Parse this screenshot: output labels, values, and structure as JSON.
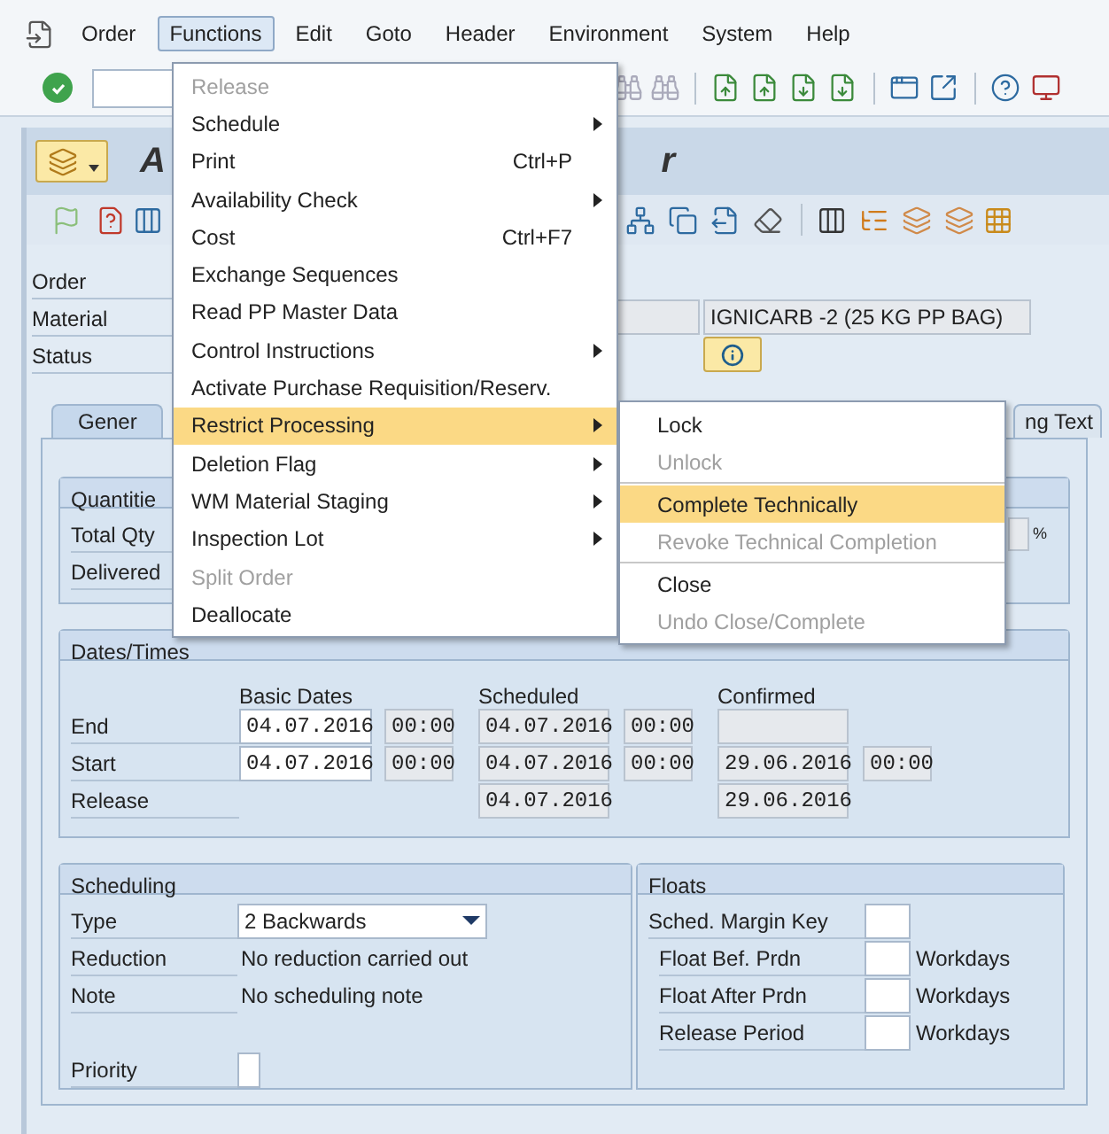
{
  "menu_bar": [
    {
      "label": "Order",
      "selected": false
    },
    {
      "label": "Functions",
      "selected": true
    },
    {
      "label": "Edit",
      "selected": false
    },
    {
      "label": "Goto",
      "selected": false
    },
    {
      "label": "Header",
      "selected": false
    },
    {
      "label": "Environment",
      "selected": false
    },
    {
      "label": "System",
      "selected": false
    },
    {
      "label": "Help",
      "selected": false
    }
  ],
  "title": {
    "visible_start": "A",
    "visible_end": "r"
  },
  "header_fields": [
    {
      "label": "Order"
    },
    {
      "label": "Material",
      "description": "IGNICARB -2 (25 KG PP BAG)"
    },
    {
      "label": "Status"
    }
  ],
  "tabs": [
    {
      "label": "Gener",
      "selected": true
    },
    {
      "label": "ng Text",
      "selected": false
    }
  ],
  "quantities": {
    "title": "Quantitie",
    "rows": [
      {
        "label": "Total Qty",
        "unit": "%"
      },
      {
        "label": "Delivered"
      }
    ]
  },
  "dates": {
    "title": "Dates/Times",
    "columns": [
      "Basic Dates",
      "Scheduled",
      "Confirmed"
    ],
    "rows": [
      {
        "label": "End",
        "basic": {
          "date": {
            "value": "04.07.2016",
            "editable": true
          },
          "time": {
            "value": "00:00",
            "editable": false
          }
        },
        "scheduled": {
          "date": {
            "value": "04.07.2016",
            "editable": false
          },
          "time": {
            "value": "00:00",
            "editable": false
          }
        },
        "confirmed": {
          "date": {
            "editable": false
          }
        }
      },
      {
        "label": "Start",
        "basic": {
          "date": {
            "value": "04.07.2016",
            "editable": true
          },
          "time": {
            "value": "00:00",
            "editable": false
          }
        },
        "scheduled": {
          "date": {
            "value": "04.07.2016",
            "editable": false
          },
          "time": {
            "value": "00:00",
            "editable": false
          }
        },
        "confirmed": {
          "date": {
            "value": "29.06.2016",
            "editable": false
          },
          "time": {
            "value": "00:00",
            "editable": false
          }
        }
      },
      {
        "label": "Release",
        "scheduled": {
          "date": {
            "value": "04.07.2016",
            "editable": false
          }
        },
        "confirmed": {
          "date": {
            "value": "29.06.2016",
            "editable": false
          }
        }
      }
    ]
  },
  "scheduling": {
    "title": "Scheduling",
    "type": {
      "label": "Type",
      "value": "2 Backwards"
    },
    "rows": [
      {
        "label": "Reduction",
        "value": "No reduction carried out"
      },
      {
        "label": "Note",
        "value": "No scheduling note"
      }
    ],
    "priority": {
      "label": "Priority"
    }
  },
  "floats": {
    "title": "Floats",
    "rows": [
      {
        "label": "Sched. Margin Key"
      },
      {
        "label": "Float Bef. Prdn",
        "unit": "Workdays"
      },
      {
        "label": "Float After Prdn",
        "unit": "Workdays"
      },
      {
        "label": "Release Period",
        "unit": "Workdays"
      }
    ]
  },
  "functions_menu": [
    {
      "label": "Release",
      "disabled": true,
      "selected": false
    },
    {
      "label": "Schedule",
      "disabled": false,
      "selected": false,
      "submenu": true
    },
    {
      "label": "Print",
      "shortcut": "Ctrl+P",
      "disabled": false,
      "selected": false
    },
    {
      "label": "Availability Check",
      "disabled": false,
      "selected": false,
      "submenu": true
    },
    {
      "label": "Cost",
      "shortcut": "Ctrl+F7",
      "disabled": false,
      "selected": false
    },
    {
      "label": "Exchange Sequences",
      "disabled": false,
      "selected": false
    },
    {
      "label": "Read PP Master Data",
      "disabled": false,
      "selected": false
    },
    {
      "label": "Control Instructions",
      "disabled": false,
      "selected": false,
      "submenu": true
    },
    {
      "label": "Activate Purchase Requisition/Reserv.",
      "disabled": false,
      "selected": false
    },
    {
      "label": "Restrict Processing",
      "disabled": false,
      "selected": true,
      "submenu": true
    },
    {
      "label": "Deletion Flag",
      "disabled": false,
      "selected": false,
      "submenu": true
    },
    {
      "label": "WM Material Staging",
      "disabled": false,
      "selected": false,
      "submenu": true
    },
    {
      "label": "Inspection Lot",
      "disabled": false,
      "selected": false,
      "submenu": true
    },
    {
      "label": "Split Order",
      "disabled": true,
      "selected": false
    },
    {
      "label": "Deallocate",
      "disabled": false,
      "selected": false
    }
  ],
  "restrict_submenu": [
    {
      "label": "Lock",
      "disabled": false,
      "selected": false
    },
    {
      "label": "Unlock",
      "disabled": true,
      "selected": false
    },
    {
      "label": "Complete Technically",
      "disabled": false,
      "selected": true,
      "separator_before": true
    },
    {
      "label": "Revoke Technical Completion",
      "disabled": true,
      "selected": false
    },
    {
      "label": "Close",
      "disabled": false,
      "selected": false,
      "separator_before": true
    },
    {
      "label": "Undo Close/Complete",
      "disabled": true,
      "selected": false
    }
  ]
}
